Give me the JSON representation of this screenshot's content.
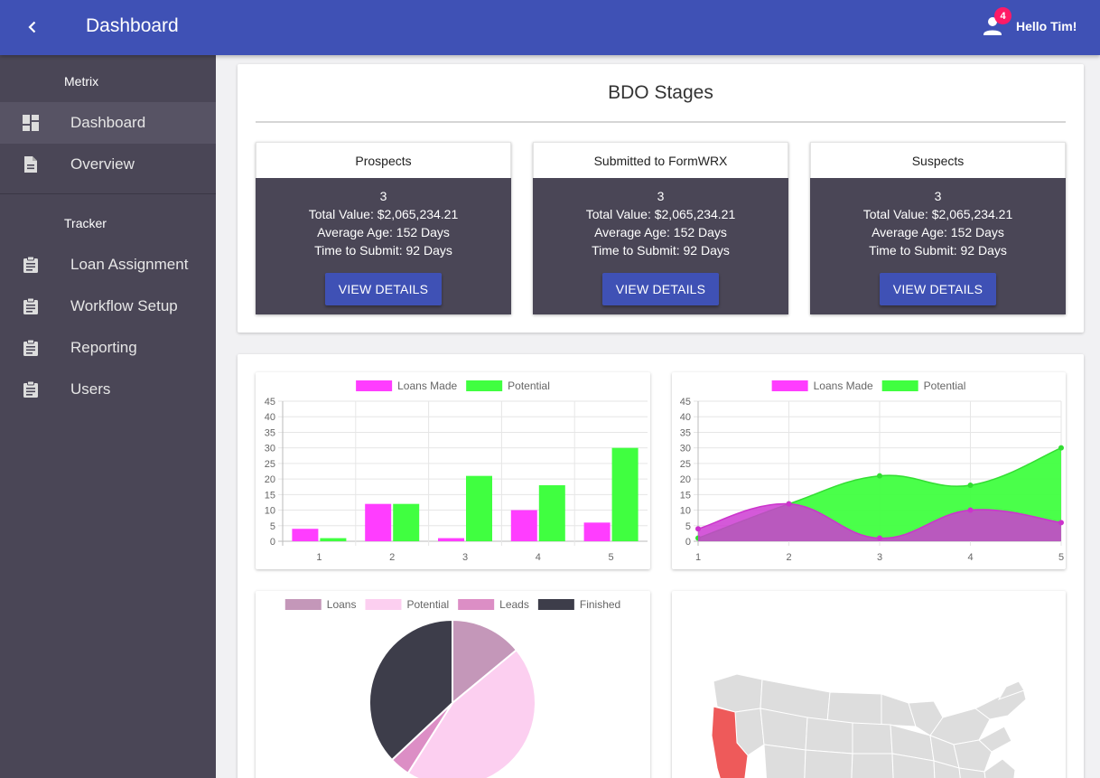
{
  "topbar": {
    "title": "Dashboard",
    "notification_count": "4",
    "greeting": "Hello Tim!"
  },
  "sidebar": {
    "sections": [
      {
        "label": "Metrix",
        "items": [
          {
            "label": "Dashboard",
            "icon": "dashboard-icon",
            "active": true
          },
          {
            "label": "Overview",
            "icon": "document-icon"
          }
        ]
      },
      {
        "label": "Tracker",
        "items": [
          {
            "label": "Loan Assignment",
            "icon": "clipboard-icon"
          },
          {
            "label": "Workflow Setup",
            "icon": "clipboard-icon"
          },
          {
            "label": "Reporting",
            "icon": "clipboard-icon"
          },
          {
            "label": "Users",
            "icon": "clipboard-icon"
          }
        ]
      }
    ]
  },
  "bdo": {
    "title": "BDO Stages",
    "stages": [
      {
        "name": "Prospects",
        "count": "3",
        "total_value": "Total Value: $2,065,234.21",
        "average_age": "Average Age: 152 Days",
        "time_to_submit": "Time to Submit: 92 Days",
        "button": "VIEW DETAILS"
      },
      {
        "name": "Submitted to FormWRX",
        "count": "3",
        "total_value": "Total Value: $2,065,234.21",
        "average_age": "Average Age: 152 Days",
        "time_to_submit": "Time to Submit: 92 Days",
        "button": "VIEW DETAILS"
      },
      {
        "name": "Suspects",
        "count": "3",
        "total_value": "Total Value: $2,065,234.21",
        "average_age": "Average Age: 152 Days",
        "time_to_submit": "Time to Submit: 92 Days",
        "button": "VIEW DETAILS"
      }
    ]
  },
  "colors": {
    "primary": "#3f51b5",
    "sidebar": "#4a4656",
    "badge": "#ff1a66",
    "loans_made": "#ff3dff",
    "potential": "#40ff40"
  },
  "chart_data": [
    {
      "type": "bar",
      "categories": [
        "1",
        "2",
        "3",
        "4",
        "5"
      ],
      "series": [
        {
          "name": "Loans Made",
          "values": [
            4,
            12,
            1,
            10,
            6
          ],
          "color": "#ff3dff"
        },
        {
          "name": "Potential",
          "values": [
            1,
            12,
            21,
            18,
            30
          ],
          "color": "#40ff40"
        }
      ],
      "ylim": [
        0,
        45
      ],
      "yticks": [
        "0",
        "5",
        "10",
        "15",
        "20",
        "25",
        "30",
        "35",
        "40",
        "45"
      ],
      "grid": true,
      "legend": "top"
    },
    {
      "type": "area",
      "categories": [
        "1",
        "2",
        "3",
        "4",
        "5"
      ],
      "series": [
        {
          "name": "Loans Made",
          "values": [
            4,
            12,
            1,
            10,
            6
          ],
          "color": "#ff3dff"
        },
        {
          "name": "Potential",
          "values": [
            1,
            12,
            21,
            18,
            30
          ],
          "color": "#40ff40"
        }
      ],
      "ylim": [
        0,
        45
      ],
      "yticks": [
        "0",
        "5",
        "10",
        "15",
        "20",
        "25",
        "30",
        "35",
        "40",
        "45"
      ],
      "grid": true,
      "legend": "top"
    },
    {
      "type": "pie",
      "labels": [
        "Loans",
        "Potential",
        "Leads",
        "Finished"
      ],
      "values": [
        14,
        45,
        4,
        37
      ],
      "colors": [
        "#c497b9",
        "#fccff0",
        "#dc8ec5",
        "#3d3d4a"
      ],
      "legend": "top"
    }
  ],
  "map": {
    "highlight_color": "#ee5a5a",
    "base_color": "#dddddd"
  }
}
